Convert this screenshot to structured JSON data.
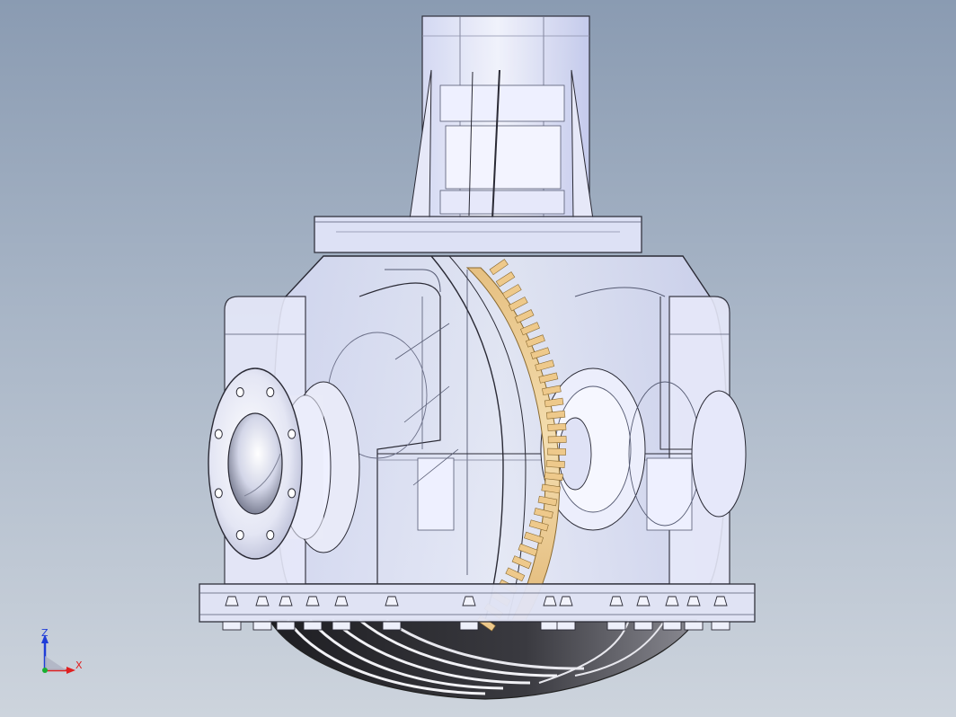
{
  "viewport": {
    "background_top": "#8a9bb2",
    "background_bottom": "#cdd4dd"
  },
  "model": {
    "part_name": "",
    "display_mode": "transparent-shaded",
    "housing_color": "#e9ecfb",
    "edge_color": "#2a2a35",
    "gear_color": "#e9c589",
    "pan_color": "#2c2c30"
  },
  "triad": {
    "z_label": "Z",
    "x_label": "X",
    "z_color": "#1f3dd8",
    "x_color": "#e02020",
    "origin_color": "#18b030"
  }
}
